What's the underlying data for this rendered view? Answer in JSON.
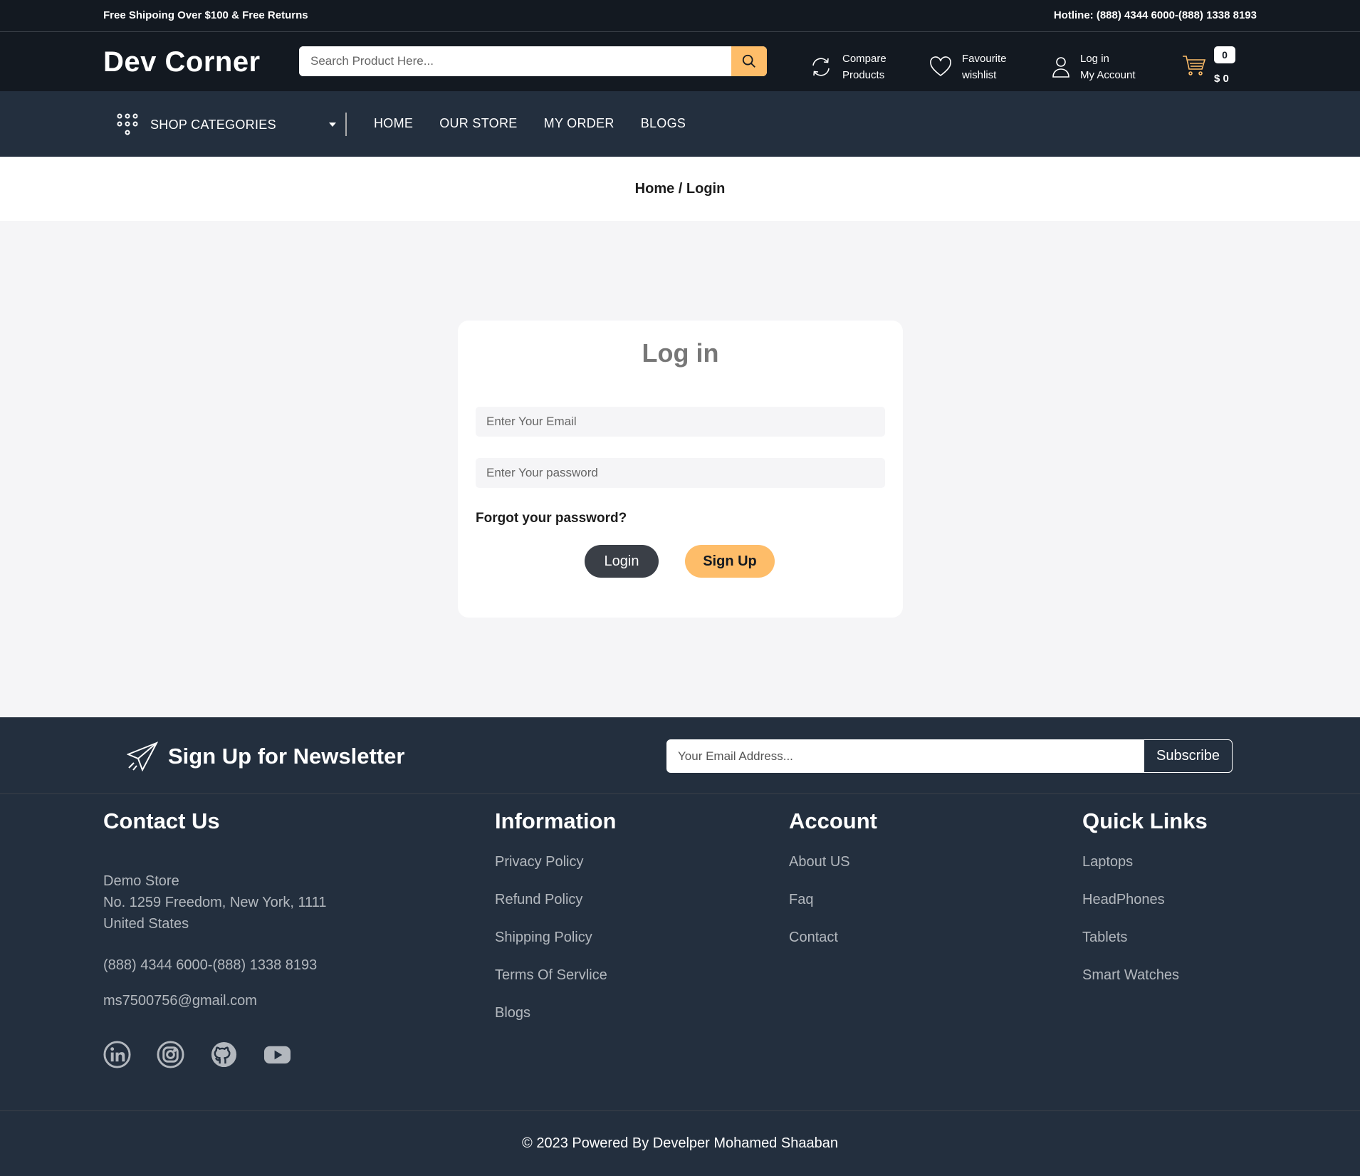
{
  "topbar": {
    "left_text": "Free Shipoing Over $100 & Free Returns",
    "right_text": "Hotline: (888) 4344 6000-(888) 1338 8193"
  },
  "header": {
    "logo": "Dev Corner",
    "search_placeholder": "Search Product Here...",
    "links": [
      {
        "line1": "Compare",
        "line2": "Products",
        "icon": "compare-icon"
      },
      {
        "line1": "Favourite",
        "line2": "wishlist",
        "icon": "heart-icon"
      },
      {
        "line1": "Log in",
        "line2": "My Account",
        "icon": "user-icon"
      }
    ],
    "cart": {
      "count": "0",
      "total": "$ 0",
      "icon": "cart-icon"
    }
  },
  "nav": {
    "categories_label": "SHOP CATEGORIES",
    "items": [
      "HOME",
      "OUR STORE",
      "MY ORDER",
      "BLOGS"
    ]
  },
  "breadcrumb": {
    "text": "Home / Login"
  },
  "login": {
    "title": "Log in",
    "email_placeholder": "Enter Your Email",
    "password_placeholder": "Enter Your password",
    "forgot": "Forgot your password?",
    "login_button": "Login",
    "signup_button": "Sign Up"
  },
  "newsletter": {
    "title": "Sign Up for Newsletter",
    "placeholder": "Your Email Address...",
    "button": "Subscribe"
  },
  "footer": {
    "contact": {
      "title": "Contact Us",
      "address": [
        "Demo Store",
        "No. 1259 Freedom, New York, 1111",
        "United States"
      ],
      "phone": "(888) 4344 6000-(888) 1338 8193",
      "email": "ms7500756@gmail.com",
      "social": [
        "linkedin-icon",
        "instagram-icon",
        "github-icon",
        "youtube-icon"
      ]
    },
    "information": {
      "title": "Information",
      "links": [
        "Privacy Policy",
        "Refund Policy",
        "Shipping Policy",
        "Terms Of Servlice",
        "Blogs"
      ]
    },
    "account": {
      "title": "Account",
      "links": [
        "About US",
        "Faq",
        "Contact"
      ]
    },
    "quick_links": {
      "title": "Quick Links",
      "links": [
        "Laptops",
        "HeadPhones",
        "Tablets",
        "Smart Watches"
      ]
    }
  },
  "copyright": "© 2023 Powered By Develper Mohamed Shaaban",
  "colors": {
    "dark": "#131921",
    "navy": "#232f3e",
    "accent": "#febd69",
    "button_dark": "#3a3f47",
    "page_bg": "#f5f5f7"
  }
}
